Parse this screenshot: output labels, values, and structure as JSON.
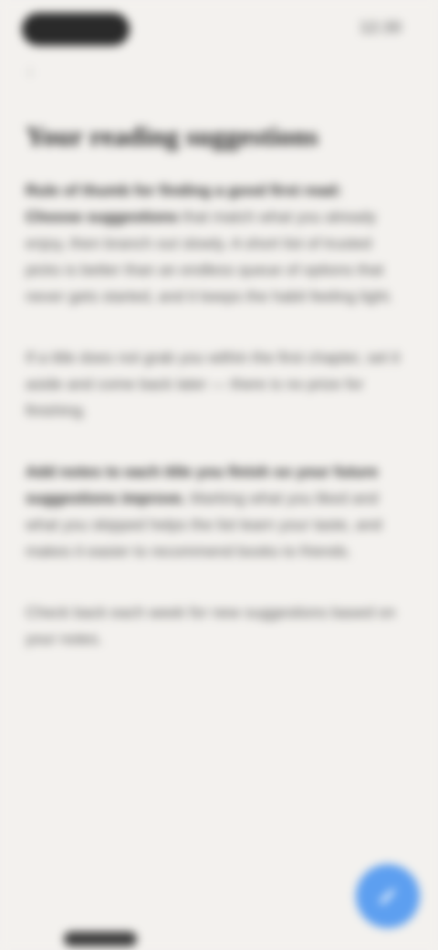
{
  "status_bar": {
    "time": "12:30"
  },
  "content": {
    "title": "Your reading suggestions",
    "paragraphs": [
      {
        "lead": "Rule of thumb for finding a good first read: Choose suggestions",
        "text": " that match what you already enjoy, then branch out slowly. A short list of trusted picks is better than an endless queue of options that never gets started, and it keeps the habit feeling light."
      },
      {
        "lead": "",
        "text": "If a title does not grab you within the first chapter, set it aside and come back later — there is no prize for finishing."
      },
      {
        "lead": "Add notes to each title you finish so your future suggestions improve.",
        "text": " Marking what you liked and what you skipped helps the list learn your taste, and makes it easier to recommend books to friends."
      },
      {
        "lead": "",
        "text": "Check back each week for new suggestions based on your notes."
      }
    ]
  },
  "fab": {
    "icon": "compose-icon",
    "color": "#5d9ff0"
  },
  "colors": {
    "background": "#f3f1ee",
    "text": "#2b2b2b",
    "accent": "#5d9ff0"
  }
}
